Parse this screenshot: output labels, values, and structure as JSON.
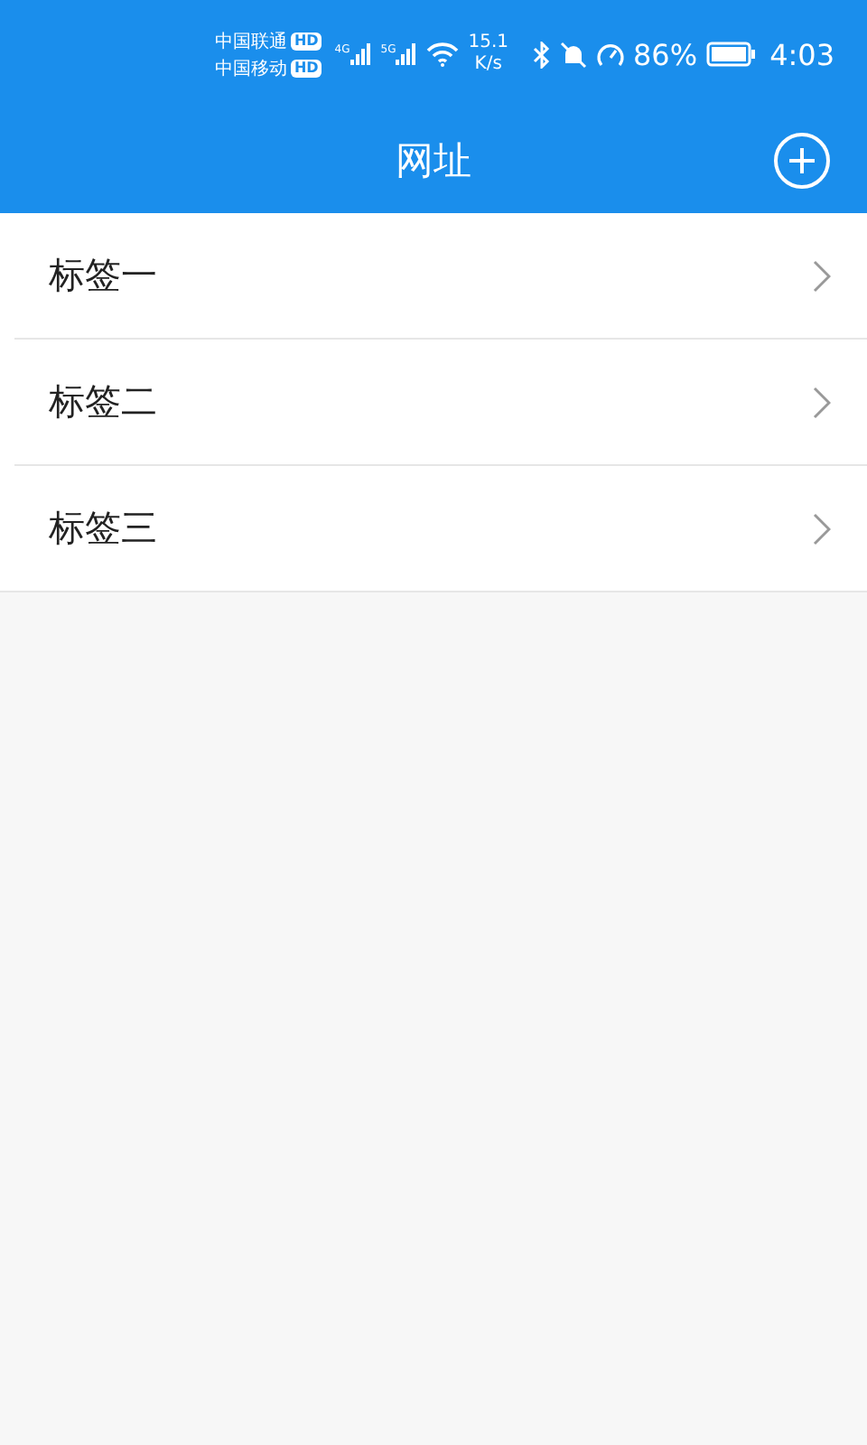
{
  "status_bar": {
    "carriers": [
      {
        "name": "中国联通",
        "badge": "HD",
        "network": "4G"
      },
      {
        "name": "中国移动",
        "badge": "HD",
        "network": "5G"
      }
    ],
    "speed_value": "15.1",
    "speed_unit": "K/s",
    "battery_percent": "86%",
    "time": "4:03"
  },
  "header": {
    "title": "网址"
  },
  "items": [
    {
      "label": "标签一"
    },
    {
      "label": "标签二"
    },
    {
      "label": "标签三"
    }
  ]
}
